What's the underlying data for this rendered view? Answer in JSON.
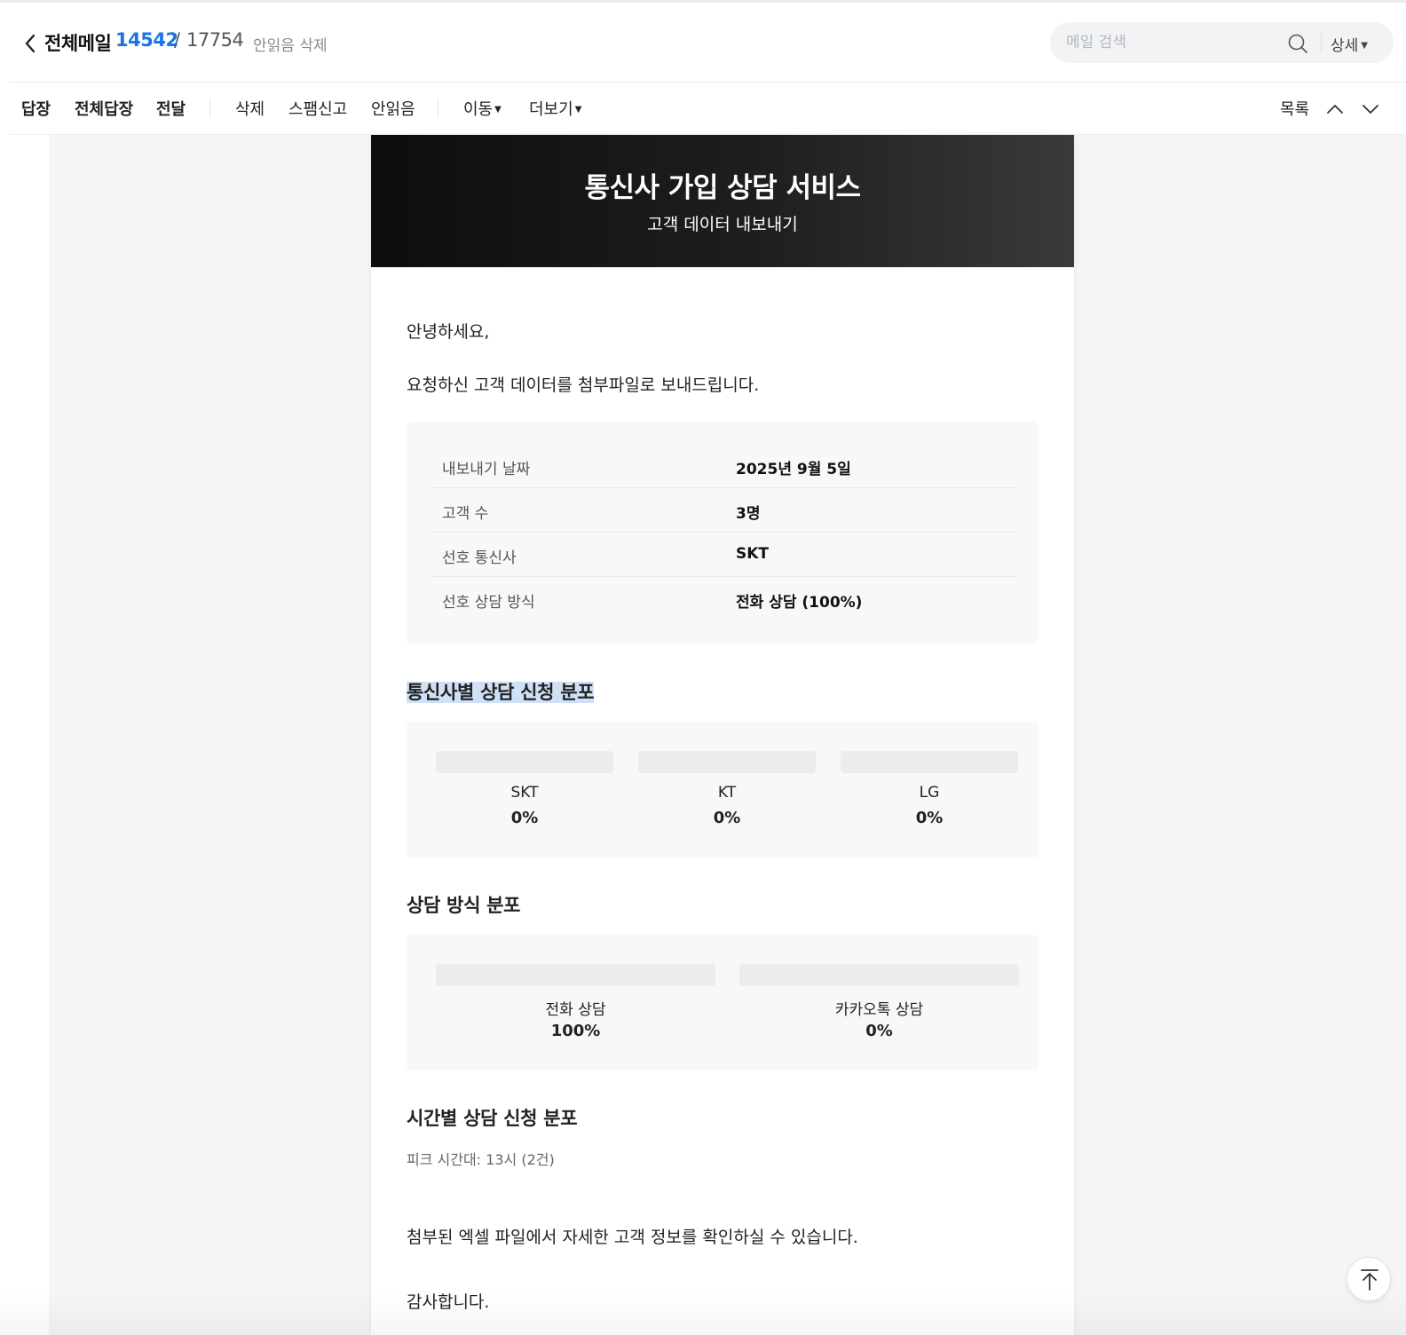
{
  "header": {
    "mailbox_title": "전체메일",
    "unread_count": "14542",
    "separator": "/",
    "total_count": "17754",
    "delete_unread_label": "안읽음 삭제",
    "search_placeholder": "메일 검색",
    "detail_label": "상세"
  },
  "toolbar": {
    "reply": "답장",
    "reply_all": "전체답장",
    "forward": "전달",
    "delete": "삭제",
    "spam": "스팸신고",
    "mark_unread": "안읽음",
    "move": "이동",
    "more": "더보기",
    "list": "목록"
  },
  "mail": {
    "banner_title": "통신사 가입 상담 서비스",
    "banner_subtitle": "고객 데이터 내보내기",
    "greeting": "안녕하세요,",
    "intro": "요청하신 고객 데이터를 첨부파일로 보내드립니다.",
    "summary": [
      {
        "label": "내보내기 날짜",
        "value": "2025년 9월 5일"
      },
      {
        "label": "고객 수",
        "value": "3명"
      },
      {
        "label": "선호 통신사",
        "value": "SKT"
      },
      {
        "label": "선호 상담 방식",
        "value": "전화 상담 (100%)"
      }
    ],
    "carrier_section_title": "통신사별 상담 신청 분포",
    "carriers": [
      {
        "name": "SKT",
        "percent_label": "0%",
        "percent": 0
      },
      {
        "name": "KT",
        "percent_label": "0%",
        "percent": 0
      },
      {
        "name": "LG",
        "percent_label": "0%",
        "percent": 0
      }
    ],
    "method_section_title": "상담 방식 분포",
    "methods": [
      {
        "name": "전화 상담",
        "percent_label": "100%",
        "percent": 100
      },
      {
        "name": "카카오톡 상담",
        "percent_label": "0%",
        "percent": 0
      }
    ],
    "time_section_title": "시간별 상담 신청 분포",
    "peak_text": "피크 시간대: 13시 (2건)",
    "closing": "첨부된 엑셀 파일에서 자세한 고객 정보를 확인하실 수 있습니다.",
    "thanks": "감사합니다."
  },
  "colors": {
    "accent_blue": "#1a73e8",
    "banner_dark": "#0d0d0d",
    "selection_highlight": "#cfe1f6"
  },
  "icons": {
    "back": "chevron-left-icon",
    "search": "search-icon",
    "prev": "chevron-up-icon",
    "next": "chevron-down-icon",
    "scroll_top": "arrow-up-to-line-icon"
  }
}
